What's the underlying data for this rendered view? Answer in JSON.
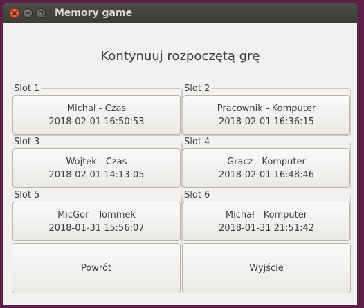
{
  "window": {
    "title": "Memory game"
  },
  "heading": "Kontynuuj rozpoczętą grę",
  "slots": [
    {
      "label": "Slot 1",
      "line1": "Michał - Czas",
      "line2": "2018-02-01 16:50:53"
    },
    {
      "label": "Slot 2",
      "line1": "Pracownik - Komputer",
      "line2": "2018-02-01 16:36:15"
    },
    {
      "label": "Slot 3",
      "line1": "Wojtek - Czas",
      "line2": "2018-02-01 14:13:05"
    },
    {
      "label": "Slot 4",
      "line1": "Gracz - Komputer",
      "line2": "2018-02-01 16:48:46"
    },
    {
      "label": "Slot 5",
      "line1": "MicGor - Tommek",
      "line2": "2018-01-31 15:56:07"
    },
    {
      "label": "Slot 6",
      "line1": "Michał - Komputer",
      "line2": "2018-01-31 21:51:42"
    }
  ],
  "actions": {
    "back_label": "Powrót",
    "exit_label": "Wyjście"
  }
}
